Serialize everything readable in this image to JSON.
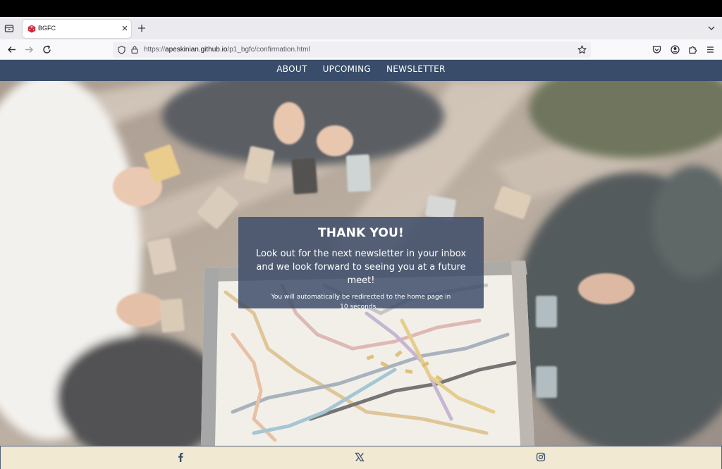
{
  "browser": {
    "tab": {
      "title": "BGFC"
    },
    "url": {
      "prefix": "https://",
      "host": "apeskinian.github.io",
      "path": "/p1_bgfc/confirmation.html"
    },
    "icons": [
      "tab-list-icon",
      "favicon-icon",
      "close-icon",
      "plus-icon",
      "chevron-down-icon",
      "back-arrow-icon",
      "forward-arrow-icon",
      "reload-icon",
      "shield-icon",
      "lock-icon",
      "star-icon",
      "pocket-icon",
      "account-icon",
      "extensions-icon",
      "menu-icon"
    ]
  },
  "site_nav": {
    "items": [
      {
        "label": "ABOUT"
      },
      {
        "label": "UPCOMING"
      },
      {
        "label": "NEWSLETTER"
      }
    ]
  },
  "confirmation": {
    "title": "THANK YOU!",
    "message": "Look out for the next newsletter in your inbox and we look forward to seeing you at a future meet!",
    "redirect": "You will automatically be redirected to the home page in 10 seconds..."
  },
  "footer": {
    "social": [
      "facebook-icon",
      "x-icon",
      "instagram-icon"
    ]
  },
  "colors": {
    "nav_bg": "#394c6a",
    "card_bg": "#3c4b69",
    "footer_bg": "#f2e9d3"
  }
}
